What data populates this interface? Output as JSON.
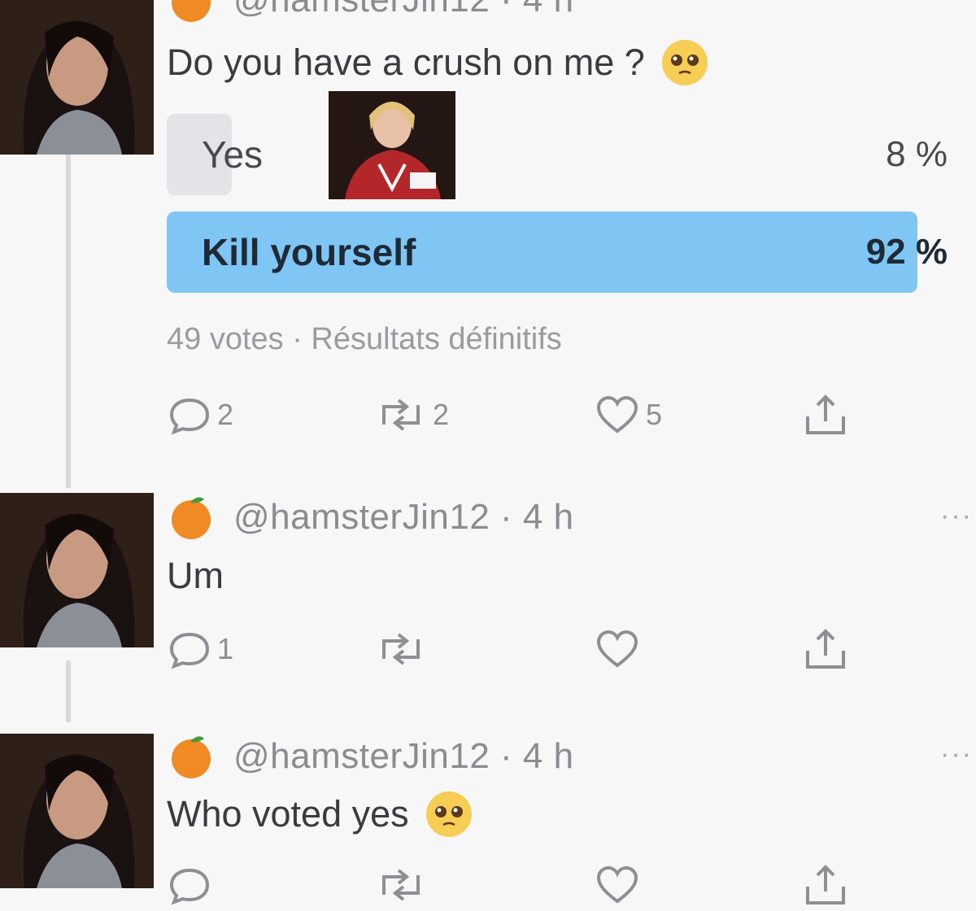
{
  "colors": {
    "poll_fill_winner": "#7fc6f5",
    "poll_fill_loser": "#e3e3e8",
    "text": "#3a3a3c",
    "muted": "#8e8e93"
  },
  "tweets": [
    {
      "handle": "@hamsterJin12 · 4 h",
      "text": "Do you have a crush on me ?",
      "emoji": "pleading-face",
      "poll": {
        "options": [
          {
            "label": "Yes",
            "percent_text": "8 %",
            "percent": 8
          },
          {
            "label": "Kill yourself",
            "percent_text": "92 %",
            "percent": 92
          }
        ],
        "footer": "49 votes · Résultats définitifs"
      },
      "actions": {
        "reply_count": "2",
        "retweet_count": "2",
        "like_count": "5"
      }
    },
    {
      "handle": "@hamsterJin12 · 4 h",
      "text": "Um",
      "actions": {
        "reply_count": "1",
        "retweet_count": "",
        "like_count": ""
      }
    },
    {
      "handle": "@hamsterJin12 · 4 h",
      "text": "Who voted yes",
      "emoji": "pleading-face",
      "actions": {
        "reply_count": "",
        "retweet_count": "",
        "like_count": ""
      }
    }
  ],
  "icons": {
    "reply": "speech-bubble-icon",
    "retweet": "retweet-icon",
    "like": "heart-icon",
    "share": "share-icon",
    "more": "more-dots-icon",
    "avatar_emoji": "orange-icon"
  }
}
